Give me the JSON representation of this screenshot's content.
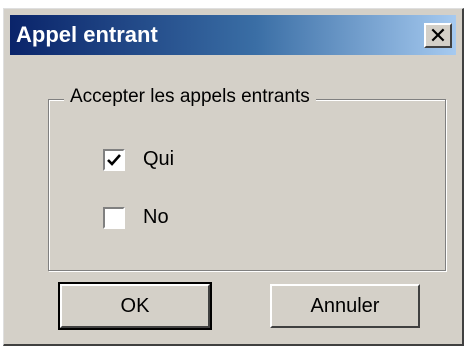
{
  "window": {
    "title": "Appel entrant",
    "close_symbol": "✕"
  },
  "group": {
    "legend": "Accepter les appels entrants",
    "options": [
      {
        "label": "Qui",
        "checked": true
      },
      {
        "label": "No",
        "checked": false
      }
    ]
  },
  "buttons": {
    "ok": "OK",
    "cancel": "Annuler"
  },
  "colors": {
    "title_start": "#0a246a",
    "title_end": "#a6caf0",
    "face": "#d4d0c8"
  }
}
